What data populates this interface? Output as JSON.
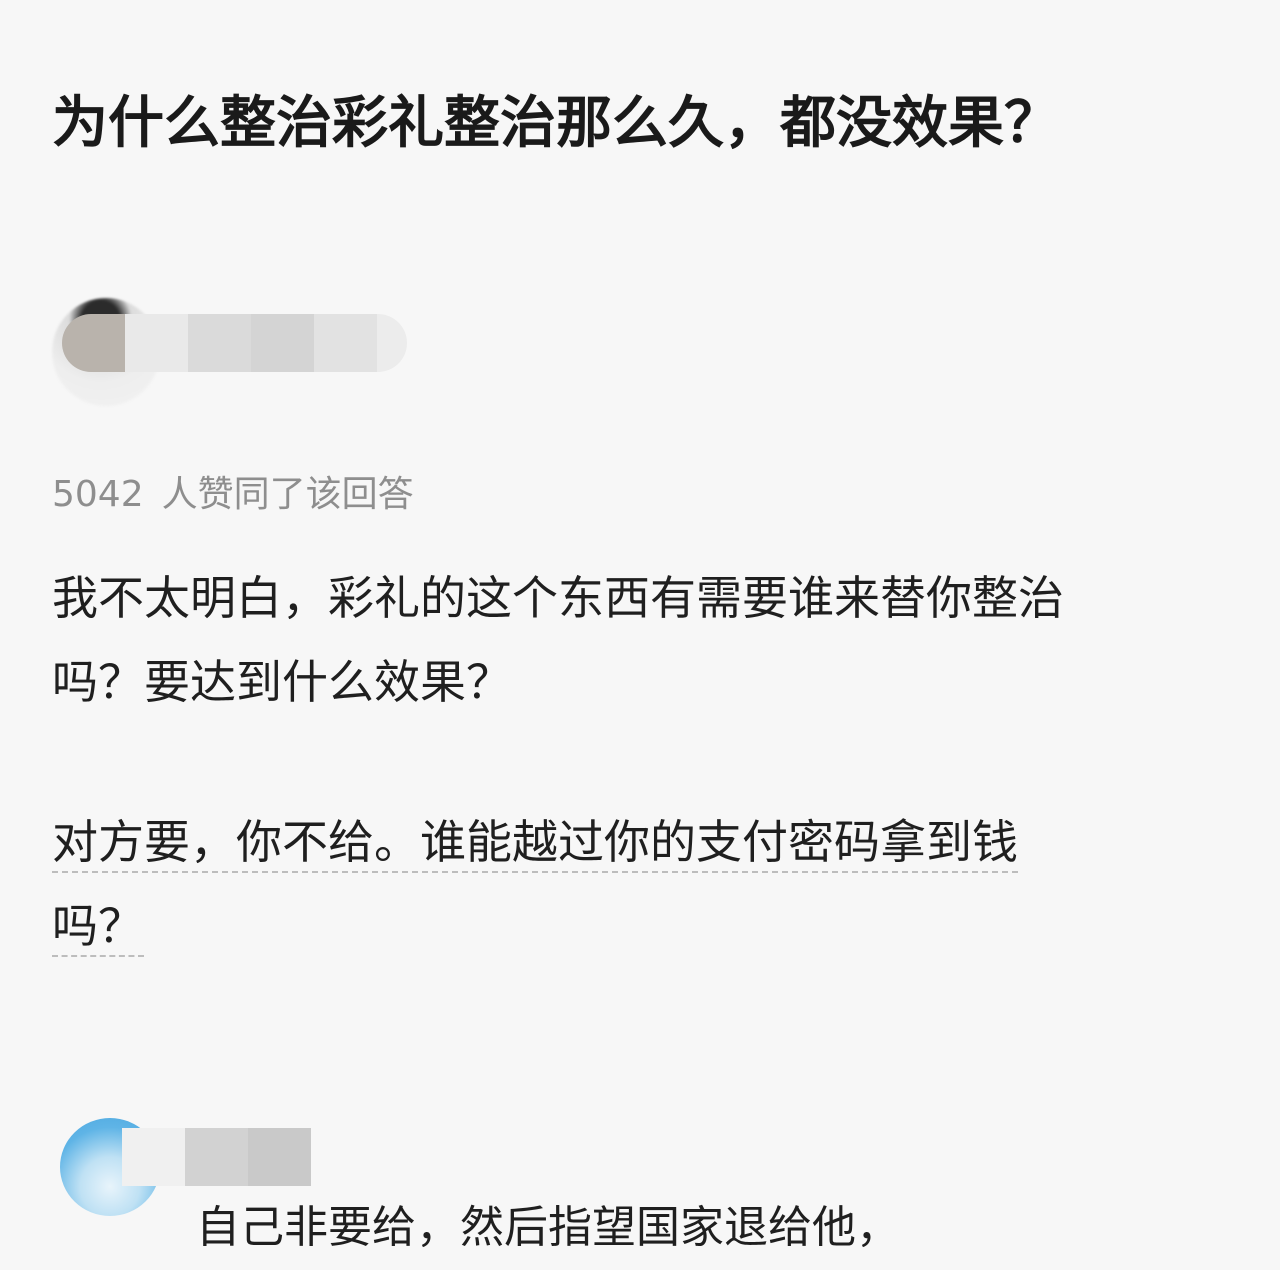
{
  "question": {
    "title": "为什么整治彩礼整治那么久，都没效果？"
  },
  "answer": {
    "vote_count": "5042",
    "vote_label": "人赞同了该回答",
    "paragraphs": [
      {
        "lines": [
          "我不太明白，彩礼的这个东西有需要谁来替你整治",
          "吗？要达到什么效果？"
        ]
      },
      {
        "lines": [
          "对方要，你不给。谁能越过你的支付密码拿到钱",
          "吗？"
        ]
      }
    ]
  },
  "reply": {
    "text": "自己非要给，然后指望国家退给他，"
  }
}
